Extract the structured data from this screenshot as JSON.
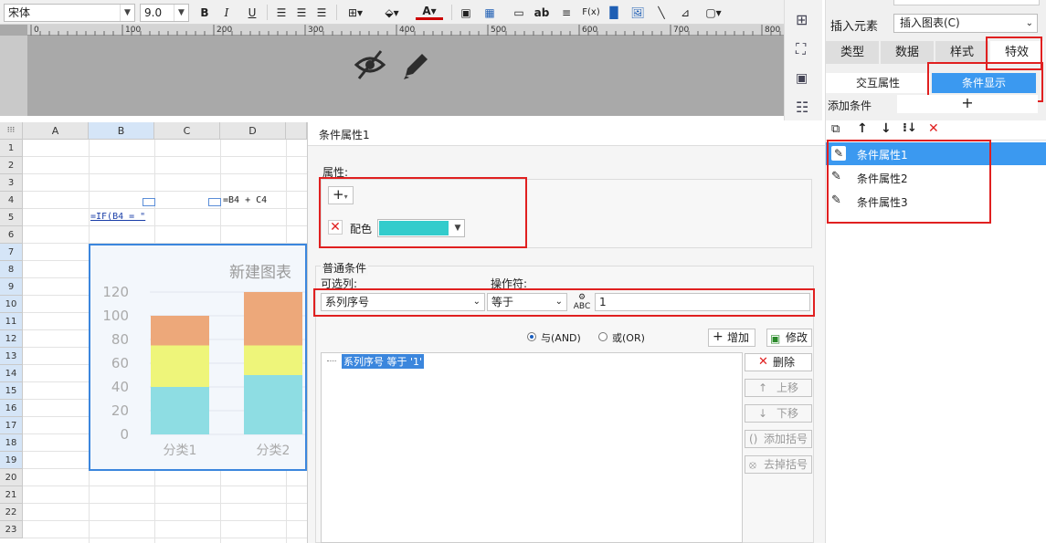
{
  "toolbar": {
    "font_name": "宋体",
    "font_size": "9.0",
    "bold": "B",
    "italic": "I",
    "underline": "U",
    "text_label": "ab",
    "formula_label": "F(x)"
  },
  "ruler": {
    "marks": [
      "0",
      "100",
      "200",
      "300",
      "400",
      "500",
      "600",
      "700",
      "800"
    ]
  },
  "sheet": {
    "columns": [
      "A",
      "B",
      "C",
      "D"
    ],
    "rows": [
      "1",
      "2",
      "3",
      "4",
      "5",
      "6",
      "7",
      "8",
      "9",
      "10",
      "11",
      "12",
      "13",
      "14",
      "15",
      "16",
      "17",
      "18",
      "19",
      "20",
      "21",
      "22",
      "23"
    ],
    "d4_formula": "=B4 + C4",
    "b5_formula": "=IF(B4 = \""
  },
  "chart_data": {
    "type": "bar",
    "title": "新建图表",
    "categories": [
      "分类1",
      "分类2"
    ],
    "stacked": true,
    "series": [
      {
        "values": [
          40,
          50
        ],
        "color": "#8edde3"
      },
      {
        "values": [
          35,
          25
        ],
        "color": "#eef57a"
      },
      {
        "values": [
          25,
          45
        ],
        "color": "#eda87a"
      }
    ],
    "ylim": [
      0,
      120
    ],
    "yticks": [
      "0",
      "20",
      "40",
      "60",
      "80",
      "100",
      "120"
    ],
    "grid": true
  },
  "dialog": {
    "title": "条件属性1",
    "attr_label": "属性:",
    "add_symbol": "+",
    "color_label": "配色",
    "color_value": "#33cccc",
    "normal_cond_label": "普通条件",
    "optional_col_label": "可选列:",
    "operator_label": "操作符:",
    "column_value": "系列序号",
    "operator_value": "等于",
    "input_value": "1",
    "and_label": "与(AND)",
    "or_label": "或(OR)",
    "add_button": "增加",
    "modify_button": "修改",
    "condition_item": "系列序号 等于 '1'",
    "delete_button": "删除",
    "up_button": "上移",
    "down_button": "下移",
    "add_paren_button": "添加括号",
    "remove_paren_button": "去掉括号"
  },
  "rpanel": {
    "insert_label": "插入元素",
    "insert_value": "插入图表(C)",
    "tabs": [
      "类型",
      "数据",
      "样式",
      "特效"
    ],
    "sub_tabs": [
      "交互属性",
      "条件显示"
    ],
    "add_condition_label": "添加条件",
    "add_symbol": "+",
    "items": [
      "条件属性1",
      "条件属性2",
      "条件属性3"
    ]
  }
}
